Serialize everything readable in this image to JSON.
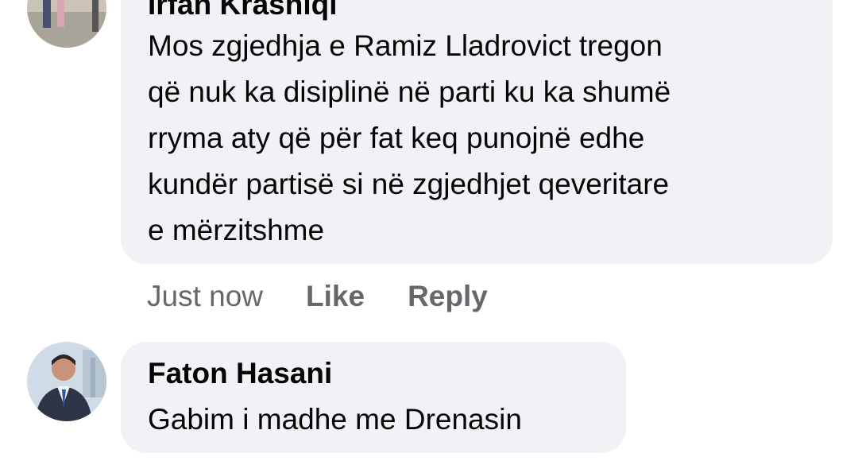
{
  "comments": [
    {
      "author": "Irfan Krasniqi",
      "text": "Mos zgjedhja e Ramiz Lladrovict tregon\nqë nuk ka disiplinë në parti ku ka shumë\nrryma aty që për fat keq punojnë edhe\nkundër partisë si në zgjedhjet qeveritare\ne mërzitshme",
      "time": "Just now",
      "like_label": "Like",
      "reply_label": "Reply",
      "avatar_icon": "person-outdoor-avatar"
    },
    {
      "author": "Faton Hasani",
      "text": "Gabim i madhe me Drenasin",
      "avatar_icon": "person-suit-avatar"
    }
  ],
  "colors": {
    "bubble_bg": "#f0f2f5",
    "text": "#050505",
    "meta_text": "#65676b"
  }
}
